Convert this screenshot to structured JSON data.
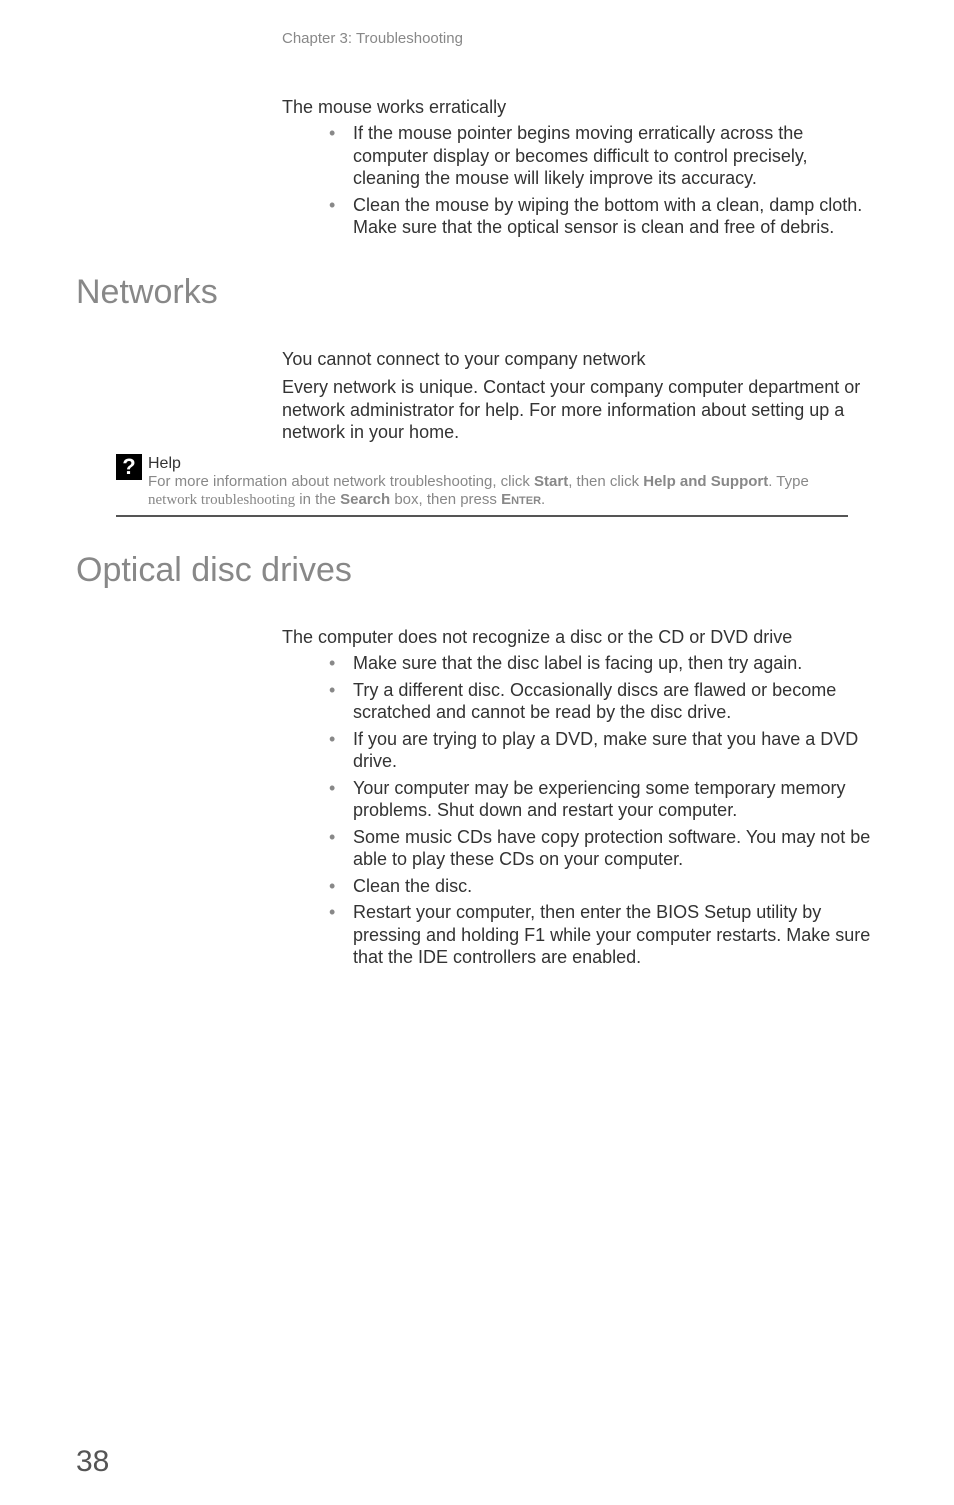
{
  "chapter_header": "Chapter 3: Troubleshooting",
  "mouse": {
    "title": "The mouse works erratically",
    "bullets": [
      "If the mouse pointer begins moving erratically across the computer display or becomes difficult to control precisely, cleaning the mouse will likely improve its accuracy.",
      "Clean the mouse by wiping the bottom with a clean, damp cloth. Make sure that the optical sensor is clean and free of debris."
    ]
  },
  "networks": {
    "heading": "Networks",
    "subtitle": "You cannot connect to your company network",
    "para": "Every network is unique. Contact your company computer department or network administrator for help. For more information about setting up a network in your home."
  },
  "help": {
    "icon": "?",
    "label": "Help",
    "line1_a": "For more information about network troubleshooting, click ",
    "start": "Start",
    "line1_b": ", then click ",
    "hns": "Help and Support",
    "line1_c": ". Type ",
    "keyword": "network troubleshooting",
    "line1_d": " in the ",
    "search": "Search",
    "line1_e": " box, then press ",
    "enter": "Enter",
    "period": "."
  },
  "optical": {
    "heading": "Optical disc drives",
    "subtitle": "The computer does not recognize a disc or the CD or DVD drive",
    "bullets": [
      "Make sure that the disc label is facing up, then try again.",
      "Try a different disc. Occasionally discs are flawed or become scratched and cannot be read by the disc drive.",
      "If you are trying to play a DVD, make sure that you have a DVD drive.",
      "Your computer may be experiencing some temporary memory problems. Shut down and restart your computer.",
      "Some music CDs have copy protection software. You may not be able to play these CDs on your computer.",
      "Clean the disc.",
      "Restart your computer, then enter the BIOS Setup utility by pressing and holding F1 while your computer restarts. Make sure that the IDE controllers are enabled."
    ]
  },
  "page_number": "38"
}
